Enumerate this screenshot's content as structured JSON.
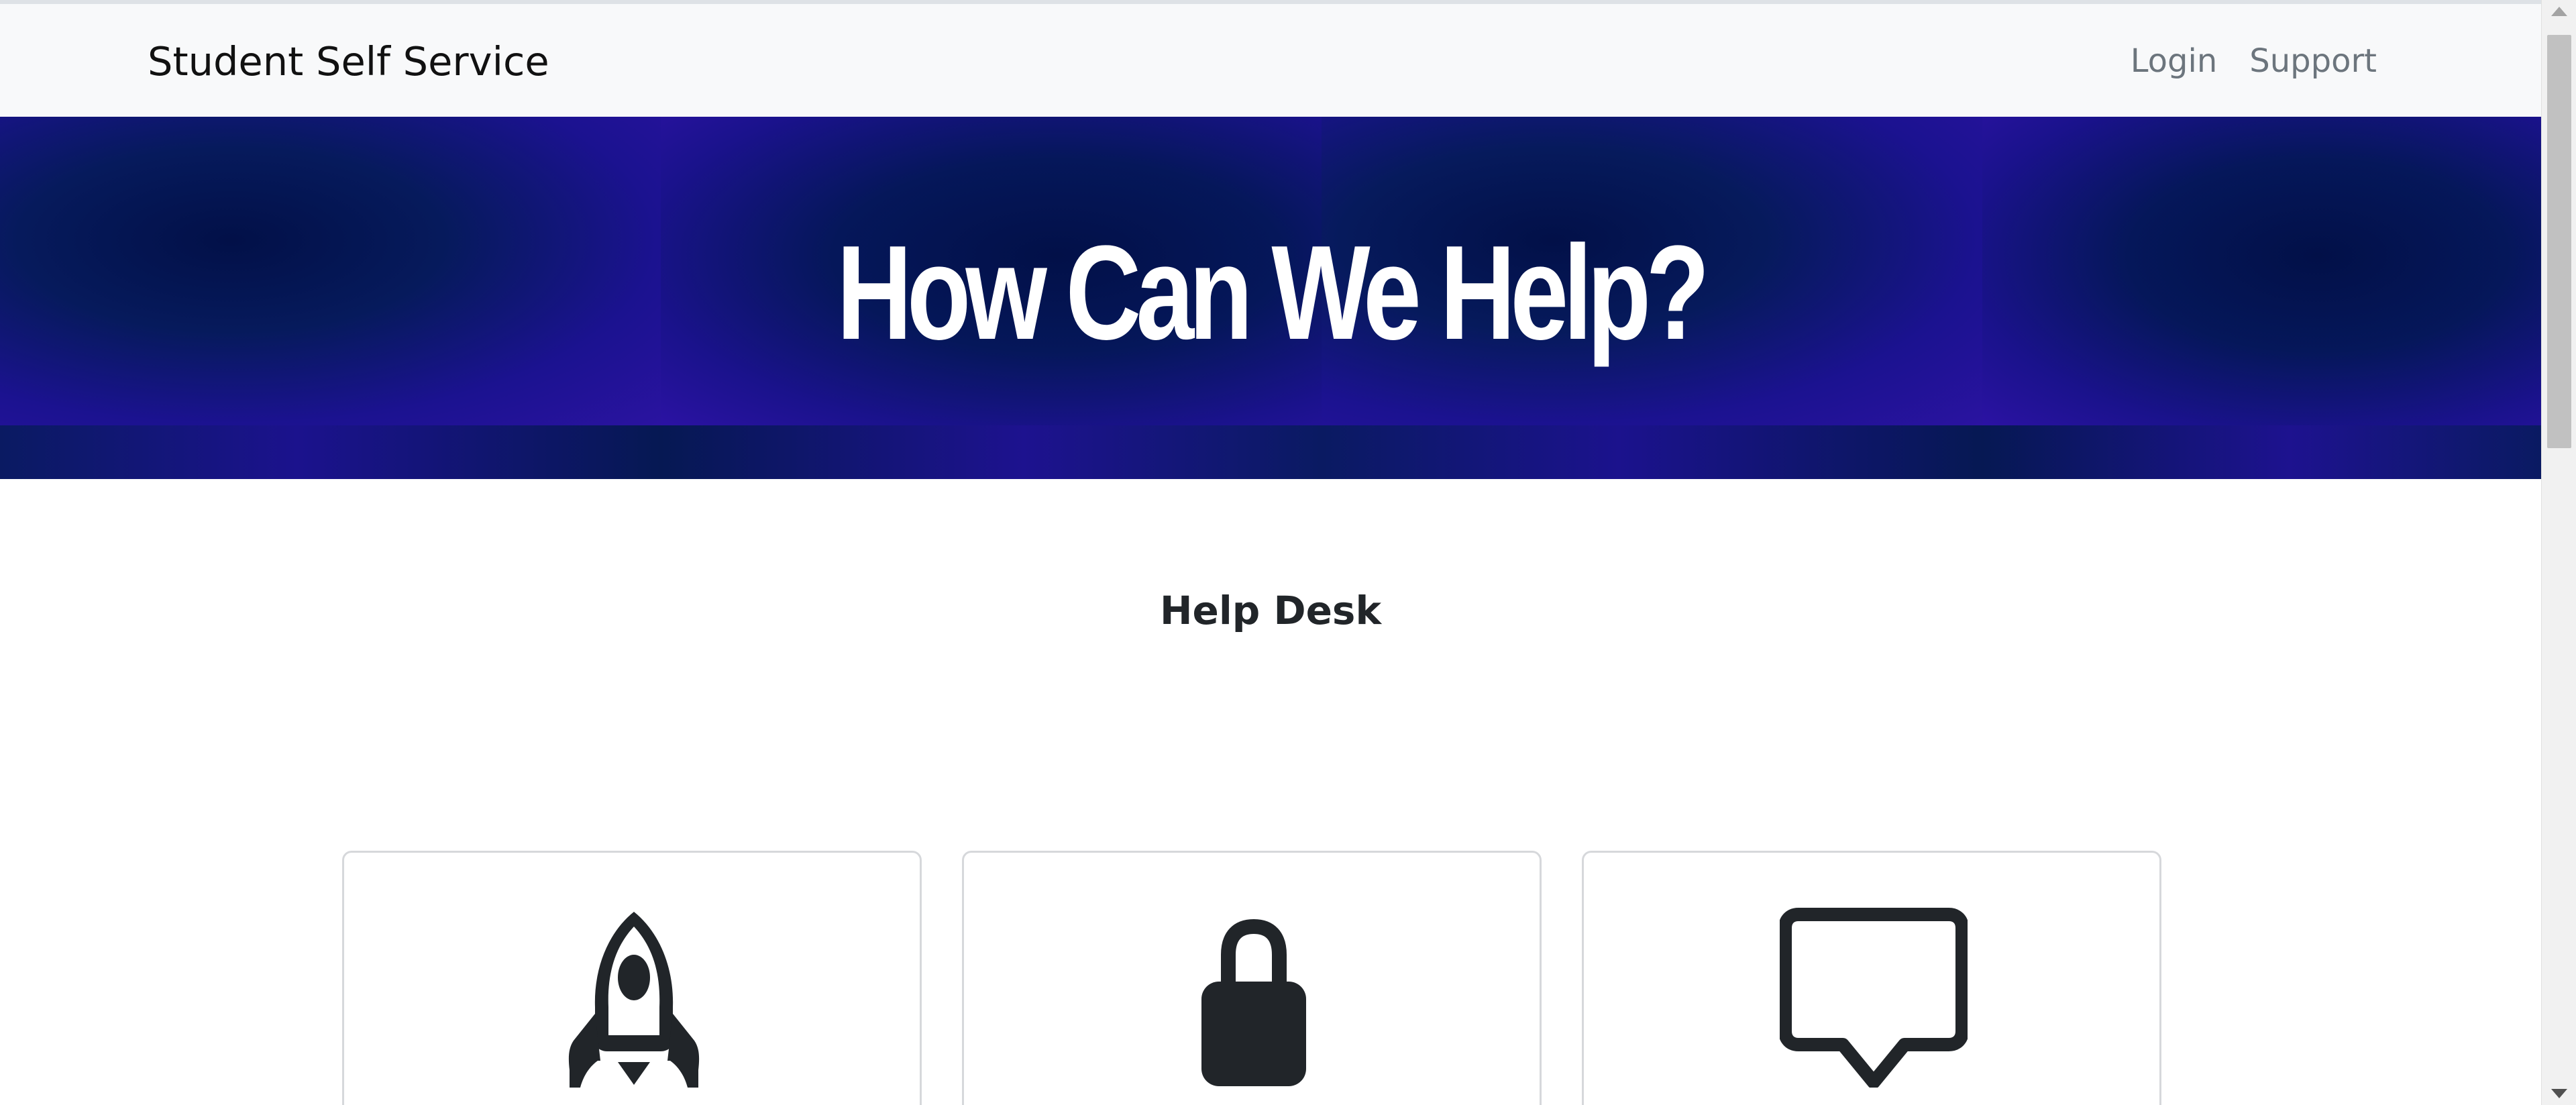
{
  "navbar": {
    "brand": "Student Self Service",
    "links": [
      {
        "label": "Login"
      },
      {
        "label": "Support"
      }
    ]
  },
  "hero": {
    "title": "How Can We Help?"
  },
  "main": {
    "heading": "Help Desk",
    "cards": [
      {
        "icon": "rocket-icon"
      },
      {
        "icon": "lock-icon"
      },
      {
        "icon": "chat-bubble-icon"
      }
    ]
  },
  "colors": {
    "hero_background": "#0a1456",
    "hero_accent": "#2a13a0",
    "navbar_background": "#f8f9fa",
    "nav_link": "#6c757d",
    "icon": "#212529"
  }
}
